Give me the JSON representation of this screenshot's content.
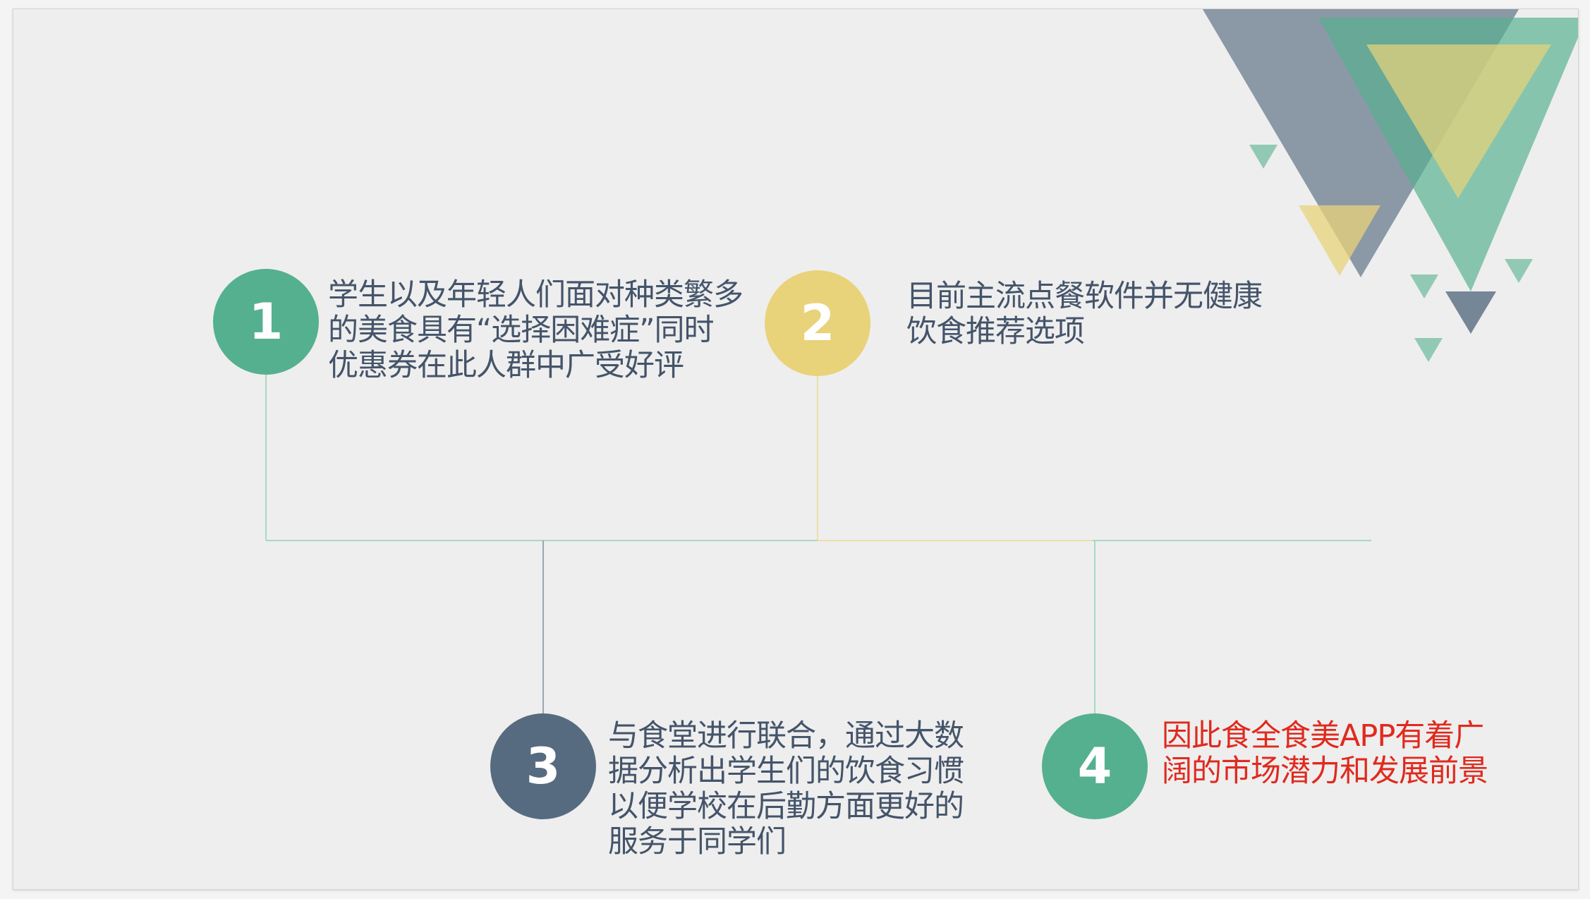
{
  "colors": {
    "teal": "#55b08f",
    "yellow": "#e8d37a",
    "slate": "#566b80",
    "text": "#44546a",
    "highlight": "#e02a1e",
    "line_teal": "#a9d8c5",
    "line_yellow": "#ecdfa6",
    "line_slate": "#9aa6b3"
  },
  "steps": [
    {
      "number": "1",
      "lines": [
        "学生以及年轻人们面对种类繁多",
        "的美食具有“选择困难症”同时",
        "优惠券在此人群中广受好评"
      ]
    },
    {
      "number": "2",
      "lines": [
        "目前主流点餐软件并无健康",
        "饮食推荐选项"
      ]
    },
    {
      "number": "3",
      "lines": [
        "与食堂进行联合，通过大数",
        "据分析出学生们的饮食习惯",
        "以便学校在后勤方面更好的",
        "服务于同学们"
      ]
    },
    {
      "number": "4",
      "lines": [
        "因此食全食美APP有着广",
        "阔的市场潜力和发展前景"
      ]
    }
  ]
}
